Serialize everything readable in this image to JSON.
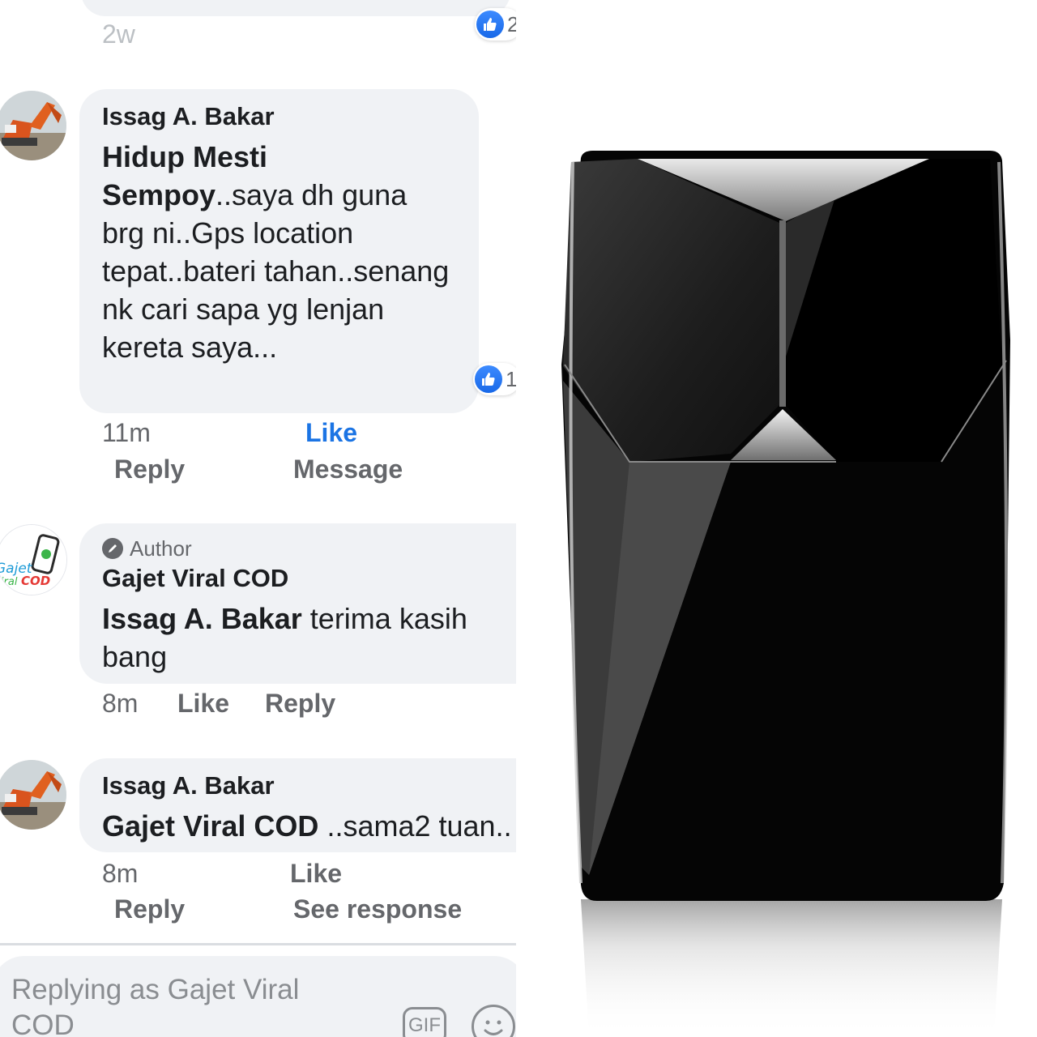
{
  "comments_panel": {
    "top_partial": {
      "time": "2w",
      "reaction_count": "2"
    },
    "comments": [
      {
        "author": "Issag A. Bakar",
        "text_bold": "Hidup Mesti Sempoy",
        "text": "..saya dh guna brg ni..Gps location tepat..bateri tahan..senang nk cari sapa yg lenjan kereta saya...",
        "time": "11m",
        "like_label": "Like",
        "reply_label": "Reply",
        "extra_action": "Message",
        "reaction_count": "1"
      },
      {
        "badge": "Author",
        "author": "Gajet Viral COD",
        "text_bold": "Issag A. Bakar",
        "text": " terima kasih bang",
        "time": "8m",
        "like_label": "Like",
        "reply_label": "Reply"
      },
      {
        "author": "Issag A. Bakar",
        "text_bold": "Gajet Viral COD",
        "text": " ..sama2 tuan..",
        "time": "8m",
        "like_label": "Like",
        "reply_label": "Reply",
        "extra_action": "See response"
      }
    ],
    "avatar_logo": {
      "line1": "Gajet",
      "line2_a": "Viral",
      "line2_b": "COD"
    },
    "reply_box": {
      "placeholder": "Replying as Gajet Viral COD",
      "gif_label": "GIF",
      "emoji_icon": "smiley-icon"
    }
  },
  "colors": {
    "bubble": "#f0f2f5",
    "link_blue": "#1b74e4",
    "meta_gray": "#65676b",
    "like_blue": "#1869e8"
  }
}
